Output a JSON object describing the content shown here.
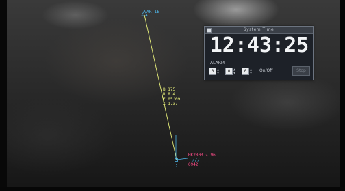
{
  "radar": {
    "fix_name": "ARTIB",
    "track_data": [
      "B 175",
      "R 8.4",
      "E 05'09",
      "X 1.37"
    ],
    "aircraft": {
      "callsign_line": "HK2803 ↘ 96",
      "alt_marks": "///",
      "code": "0942"
    }
  },
  "colors": {
    "fix": "#4fb6e8",
    "route": "#e8f07a",
    "aircraft": "#ff4d8a",
    "widget_bg": "#1d2128"
  },
  "clock_widget": {
    "title": "System Time",
    "time": "12:43:25",
    "alarm_label": "ALARM",
    "hours": "0",
    "minutes": "0",
    "seconds": "0",
    "onoff_label": "On/Off",
    "stop_label": "Stop"
  }
}
